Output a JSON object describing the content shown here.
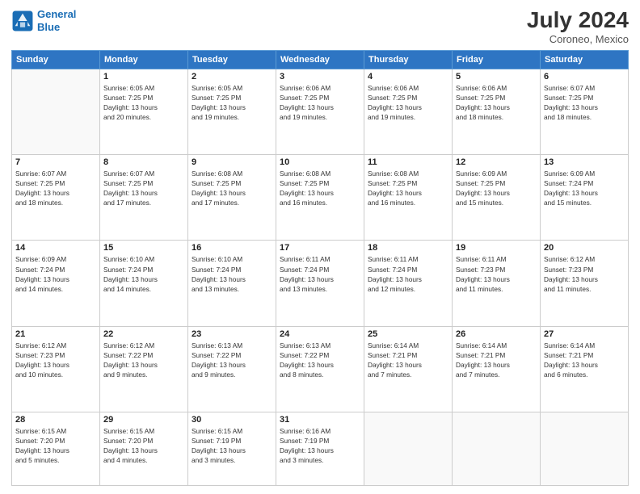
{
  "logo": {
    "line1": "General",
    "line2": "Blue"
  },
  "title": {
    "month_year": "July 2024",
    "location": "Coroneo, Mexico"
  },
  "days_of_week": [
    "Sunday",
    "Monday",
    "Tuesday",
    "Wednesday",
    "Thursday",
    "Friday",
    "Saturday"
  ],
  "weeks": [
    [
      {
        "day": "",
        "info": ""
      },
      {
        "day": "1",
        "info": "Sunrise: 6:05 AM\nSunset: 7:25 PM\nDaylight: 13 hours\nand 20 minutes."
      },
      {
        "day": "2",
        "info": "Sunrise: 6:05 AM\nSunset: 7:25 PM\nDaylight: 13 hours\nand 19 minutes."
      },
      {
        "day": "3",
        "info": "Sunrise: 6:06 AM\nSunset: 7:25 PM\nDaylight: 13 hours\nand 19 minutes."
      },
      {
        "day": "4",
        "info": "Sunrise: 6:06 AM\nSunset: 7:25 PM\nDaylight: 13 hours\nand 19 minutes."
      },
      {
        "day": "5",
        "info": "Sunrise: 6:06 AM\nSunset: 7:25 PM\nDaylight: 13 hours\nand 18 minutes."
      },
      {
        "day": "6",
        "info": "Sunrise: 6:07 AM\nSunset: 7:25 PM\nDaylight: 13 hours\nand 18 minutes."
      }
    ],
    [
      {
        "day": "7",
        "info": "Sunrise: 6:07 AM\nSunset: 7:25 PM\nDaylight: 13 hours\nand 18 minutes."
      },
      {
        "day": "8",
        "info": "Sunrise: 6:07 AM\nSunset: 7:25 PM\nDaylight: 13 hours\nand 17 minutes."
      },
      {
        "day": "9",
        "info": "Sunrise: 6:08 AM\nSunset: 7:25 PM\nDaylight: 13 hours\nand 17 minutes."
      },
      {
        "day": "10",
        "info": "Sunrise: 6:08 AM\nSunset: 7:25 PM\nDaylight: 13 hours\nand 16 minutes."
      },
      {
        "day": "11",
        "info": "Sunrise: 6:08 AM\nSunset: 7:25 PM\nDaylight: 13 hours\nand 16 minutes."
      },
      {
        "day": "12",
        "info": "Sunrise: 6:09 AM\nSunset: 7:25 PM\nDaylight: 13 hours\nand 15 minutes."
      },
      {
        "day": "13",
        "info": "Sunrise: 6:09 AM\nSunset: 7:24 PM\nDaylight: 13 hours\nand 15 minutes."
      }
    ],
    [
      {
        "day": "14",
        "info": "Sunrise: 6:09 AM\nSunset: 7:24 PM\nDaylight: 13 hours\nand 14 minutes."
      },
      {
        "day": "15",
        "info": "Sunrise: 6:10 AM\nSunset: 7:24 PM\nDaylight: 13 hours\nand 14 minutes."
      },
      {
        "day": "16",
        "info": "Sunrise: 6:10 AM\nSunset: 7:24 PM\nDaylight: 13 hours\nand 13 minutes."
      },
      {
        "day": "17",
        "info": "Sunrise: 6:11 AM\nSunset: 7:24 PM\nDaylight: 13 hours\nand 13 minutes."
      },
      {
        "day": "18",
        "info": "Sunrise: 6:11 AM\nSunset: 7:24 PM\nDaylight: 13 hours\nand 12 minutes."
      },
      {
        "day": "19",
        "info": "Sunrise: 6:11 AM\nSunset: 7:23 PM\nDaylight: 13 hours\nand 11 minutes."
      },
      {
        "day": "20",
        "info": "Sunrise: 6:12 AM\nSunset: 7:23 PM\nDaylight: 13 hours\nand 11 minutes."
      }
    ],
    [
      {
        "day": "21",
        "info": "Sunrise: 6:12 AM\nSunset: 7:23 PM\nDaylight: 13 hours\nand 10 minutes."
      },
      {
        "day": "22",
        "info": "Sunrise: 6:12 AM\nSunset: 7:22 PM\nDaylight: 13 hours\nand 9 minutes."
      },
      {
        "day": "23",
        "info": "Sunrise: 6:13 AM\nSunset: 7:22 PM\nDaylight: 13 hours\nand 9 minutes."
      },
      {
        "day": "24",
        "info": "Sunrise: 6:13 AM\nSunset: 7:22 PM\nDaylight: 13 hours\nand 8 minutes."
      },
      {
        "day": "25",
        "info": "Sunrise: 6:14 AM\nSunset: 7:21 PM\nDaylight: 13 hours\nand 7 minutes."
      },
      {
        "day": "26",
        "info": "Sunrise: 6:14 AM\nSunset: 7:21 PM\nDaylight: 13 hours\nand 7 minutes."
      },
      {
        "day": "27",
        "info": "Sunrise: 6:14 AM\nSunset: 7:21 PM\nDaylight: 13 hours\nand 6 minutes."
      }
    ],
    [
      {
        "day": "28",
        "info": "Sunrise: 6:15 AM\nSunset: 7:20 PM\nDaylight: 13 hours\nand 5 minutes."
      },
      {
        "day": "29",
        "info": "Sunrise: 6:15 AM\nSunset: 7:20 PM\nDaylight: 13 hours\nand 4 minutes."
      },
      {
        "day": "30",
        "info": "Sunrise: 6:15 AM\nSunset: 7:19 PM\nDaylight: 13 hours\nand 3 minutes."
      },
      {
        "day": "31",
        "info": "Sunrise: 6:16 AM\nSunset: 7:19 PM\nDaylight: 13 hours\nand 3 minutes."
      },
      {
        "day": "",
        "info": ""
      },
      {
        "day": "",
        "info": ""
      },
      {
        "day": "",
        "info": ""
      }
    ]
  ]
}
